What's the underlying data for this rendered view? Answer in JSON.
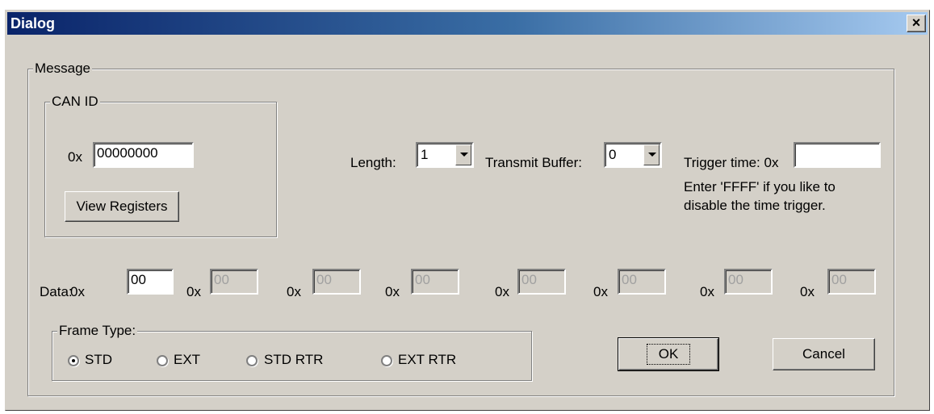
{
  "window": {
    "title": "Dialog",
    "close_label": "×"
  },
  "message_group": {
    "label": "Message"
  },
  "can_id": {
    "group_label": "CAN ID",
    "prefix": "0x",
    "value": "00000000",
    "view_registers_label": "View Registers"
  },
  "length": {
    "label": "Length:",
    "value": "1"
  },
  "transmit_buffer": {
    "label": "Transmit Buffer:",
    "value": "0"
  },
  "trigger": {
    "label": "Trigger time: 0x",
    "value": "",
    "hint_line1": "Enter 'FFFF' if you like to",
    "hint_line2": "disable the time trigger."
  },
  "data": {
    "label": "Data:",
    "prefix": "0x",
    "bytes": [
      "00",
      "00",
      "00",
      "00",
      "00",
      "00",
      "00",
      "00"
    ],
    "enabled_count": 1
  },
  "frame_type": {
    "label": "Frame Type:",
    "options": [
      "STD",
      "EXT",
      "STD RTR",
      "EXT RTR"
    ],
    "selected": "STD"
  },
  "buttons": {
    "ok": "OK",
    "cancel": "Cancel"
  }
}
